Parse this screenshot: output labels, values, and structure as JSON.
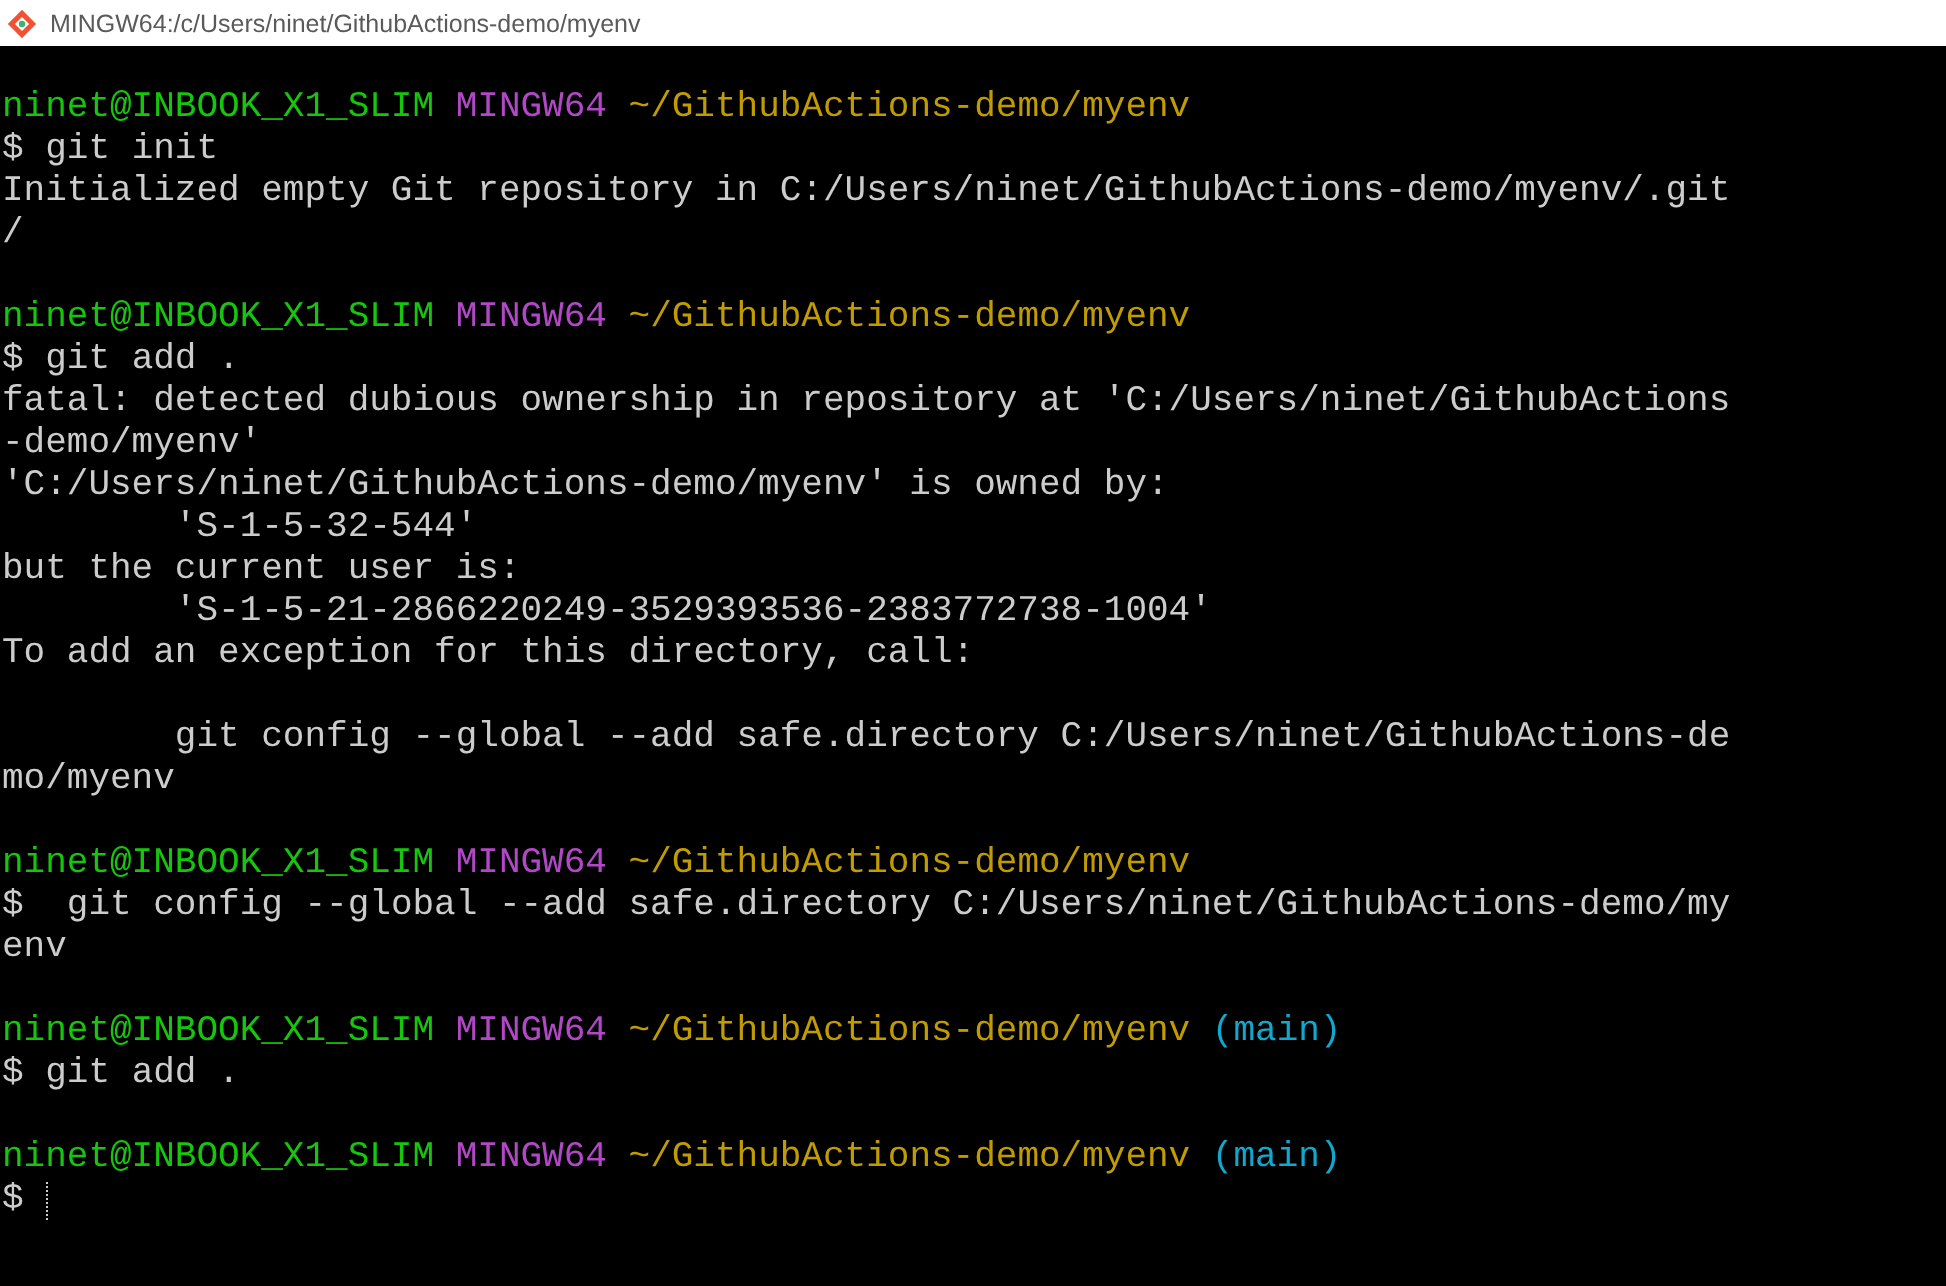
{
  "window": {
    "title": "MINGW64:/c/Users/ninet/GithubActions-demo/myenv"
  },
  "lines": [
    {
      "kind": "blank"
    },
    {
      "kind": "prompt",
      "user": "ninet@INBOOK_X1_SLIM",
      "system": "MINGW64",
      "path": "~/GithubActions-demo/myenv"
    },
    {
      "kind": "command",
      "sign": "$",
      "text": "git init"
    },
    {
      "kind": "output",
      "text": "Initialized empty Git repository in C:/Users/ninet/GithubActions-demo/myenv/.git"
    },
    {
      "kind": "output",
      "text": "/"
    },
    {
      "kind": "blank"
    },
    {
      "kind": "prompt",
      "user": "ninet@INBOOK_X1_SLIM",
      "system": "MINGW64",
      "path": "~/GithubActions-demo/myenv"
    },
    {
      "kind": "command",
      "sign": "$",
      "text": "git add ."
    },
    {
      "kind": "output",
      "text": "fatal: detected dubious ownership in repository at 'C:/Users/ninet/GithubActions"
    },
    {
      "kind": "output",
      "text": "-demo/myenv'"
    },
    {
      "kind": "output",
      "text": "'C:/Users/ninet/GithubActions-demo/myenv' is owned by:"
    },
    {
      "kind": "output",
      "text": "        'S-1-5-32-544'"
    },
    {
      "kind": "output",
      "text": "but the current user is:"
    },
    {
      "kind": "output",
      "text": "        'S-1-5-21-2866220249-3529393536-2383772738-1004'"
    },
    {
      "kind": "output",
      "text": "To add an exception for this directory, call:"
    },
    {
      "kind": "blank"
    },
    {
      "kind": "output",
      "text": "        git config --global --add safe.directory C:/Users/ninet/GithubActions-de"
    },
    {
      "kind": "output",
      "text": "mo/myenv"
    },
    {
      "kind": "blank"
    },
    {
      "kind": "prompt",
      "user": "ninet@INBOOK_X1_SLIM",
      "system": "MINGW64",
      "path": "~/GithubActions-demo/myenv"
    },
    {
      "kind": "command",
      "sign": "$",
      "text": " git config --global --add safe.directory C:/Users/ninet/GithubActions-demo/my"
    },
    {
      "kind": "output",
      "text": "env"
    },
    {
      "kind": "blank"
    },
    {
      "kind": "prompt",
      "user": "ninet@INBOOK_X1_SLIM",
      "system": "MINGW64",
      "path": "~/GithubActions-demo/myenv",
      "branch": "(main)"
    },
    {
      "kind": "command",
      "sign": "$",
      "text": "git add ."
    },
    {
      "kind": "blank"
    },
    {
      "kind": "prompt",
      "user": "ninet@INBOOK_X1_SLIM",
      "system": "MINGW64",
      "path": "~/GithubActions-demo/myenv",
      "branch": "(main)"
    },
    {
      "kind": "command",
      "sign": "$",
      "cursor": true
    }
  ]
}
